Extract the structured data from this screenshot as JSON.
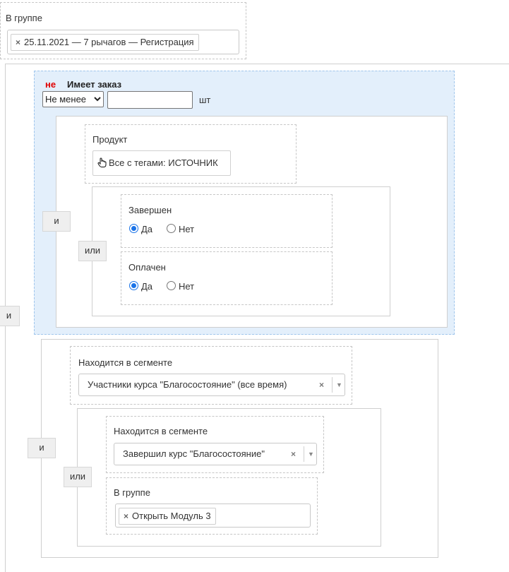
{
  "top_group": {
    "label": "В группе",
    "tag": "25.11.2021 — 7 рычагов — Регистрация"
  },
  "root_operator": "и",
  "order_block": {
    "not_label": "не",
    "title": "Имеет заказ",
    "comparator": "Не менее",
    "quantity": "",
    "unit": "шт",
    "inner_operator": "и",
    "product": {
      "label": "Продукт",
      "value": "Все с тегами: ИСТОЧНИК"
    },
    "or_operator": "или",
    "completed": {
      "label": "Завершен",
      "yes": "Да",
      "no": "Нет",
      "selected": "yes"
    },
    "paid": {
      "label": "Оплачен",
      "yes": "Да",
      "no": "Нет",
      "selected": "yes"
    }
  },
  "segment_block": {
    "operator": "и",
    "segment1": {
      "label": "Находится в сегменте",
      "value": "Участники курса \"Благосостояние\" (все время)"
    },
    "or_operator": "или",
    "segment2": {
      "label": "Находится в сегменте",
      "value": "Завершил курс \"Благосостояние\""
    },
    "group": {
      "label": "В группе",
      "tag": "Открыть Модуль 3"
    }
  },
  "colors": {
    "highlight_bg": "#e3effb",
    "highlight_border": "#9fc5ec",
    "not_color": "#e00000",
    "radio_accent": "#1a73e8"
  }
}
